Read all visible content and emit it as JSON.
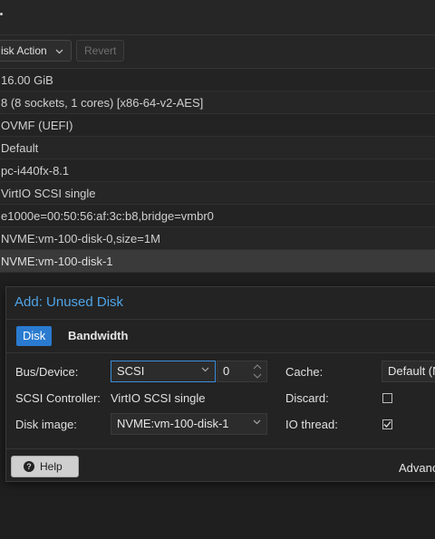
{
  "toolbar": {
    "disk_action_label": "isk Action",
    "revert_label": "Revert"
  },
  "hardware_rows": [
    "16.00 GiB",
    "8 (8 sockets, 1 cores) [x86-64-v2-AES]",
    "OVMF (UEFI)",
    "Default",
    "pc-i440fx-8.1",
    "VirtIO SCSI single",
    "e1000e=00:50:56:af:3c:b8,bridge=vmbr0",
    "NVME:vm-100-disk-0,size=1M",
    "NVME:vm-100-disk-1"
  ],
  "dialog": {
    "title": "Add: Unused Disk",
    "tabs": [
      "Disk",
      "Bandwidth"
    ],
    "bus_device_label": "Bus/Device:",
    "bus_value": "SCSI",
    "device_index": "0",
    "scsi_controller_label": "SCSI Controller:",
    "scsi_controller_value": "VirtIO SCSI single",
    "disk_image_label": "Disk image:",
    "disk_image_value": "NVME:vm-100-disk-1",
    "cache_label": "Cache:",
    "cache_value": "Default (N",
    "discard_label": "Discard:",
    "discard_checked": false,
    "io_thread_label": "IO thread:",
    "io_thread_checked": true,
    "help_label": "Help",
    "advanced_label": "Advanc"
  },
  "colors": {
    "accent": "#2a7bd0",
    "title": "#4fa4e8",
    "background": "#1f1f1f"
  }
}
